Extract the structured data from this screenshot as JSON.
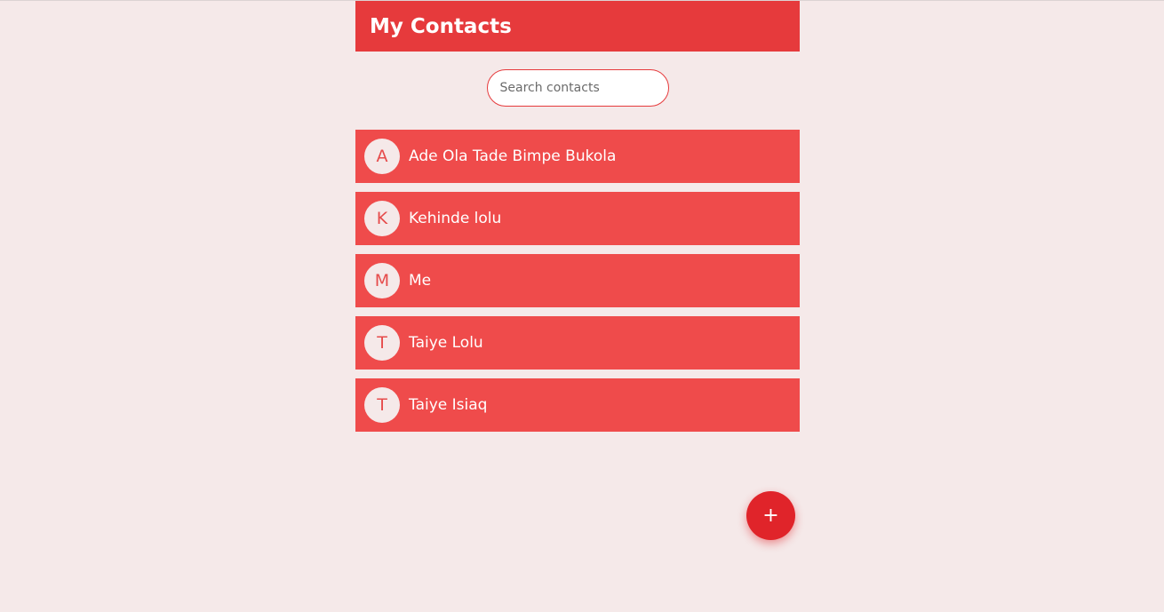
{
  "header": {
    "title": "My Contacts"
  },
  "search": {
    "placeholder": "Search contacts",
    "value": ""
  },
  "contacts": [
    {
      "initial": "A",
      "name": "Ade Ola Tade Bimpe Bukola"
    },
    {
      "initial": "K",
      "name": "Kehinde lolu"
    },
    {
      "initial": "M",
      "name": "Me"
    },
    {
      "initial": "T",
      "name": "Taiye Lolu"
    },
    {
      "initial": "T",
      "name": "Taiye Isiaq"
    }
  ],
  "fab": {
    "label": "+",
    "icon": "plus-icon"
  },
  "colors": {
    "background": "#f5e9e9",
    "header": "#e63a3c",
    "item": "#ef4b4b",
    "fab": "#e0242a",
    "avatar_bg": "#f5e9e9",
    "avatar_text": "#e64b4b"
  }
}
